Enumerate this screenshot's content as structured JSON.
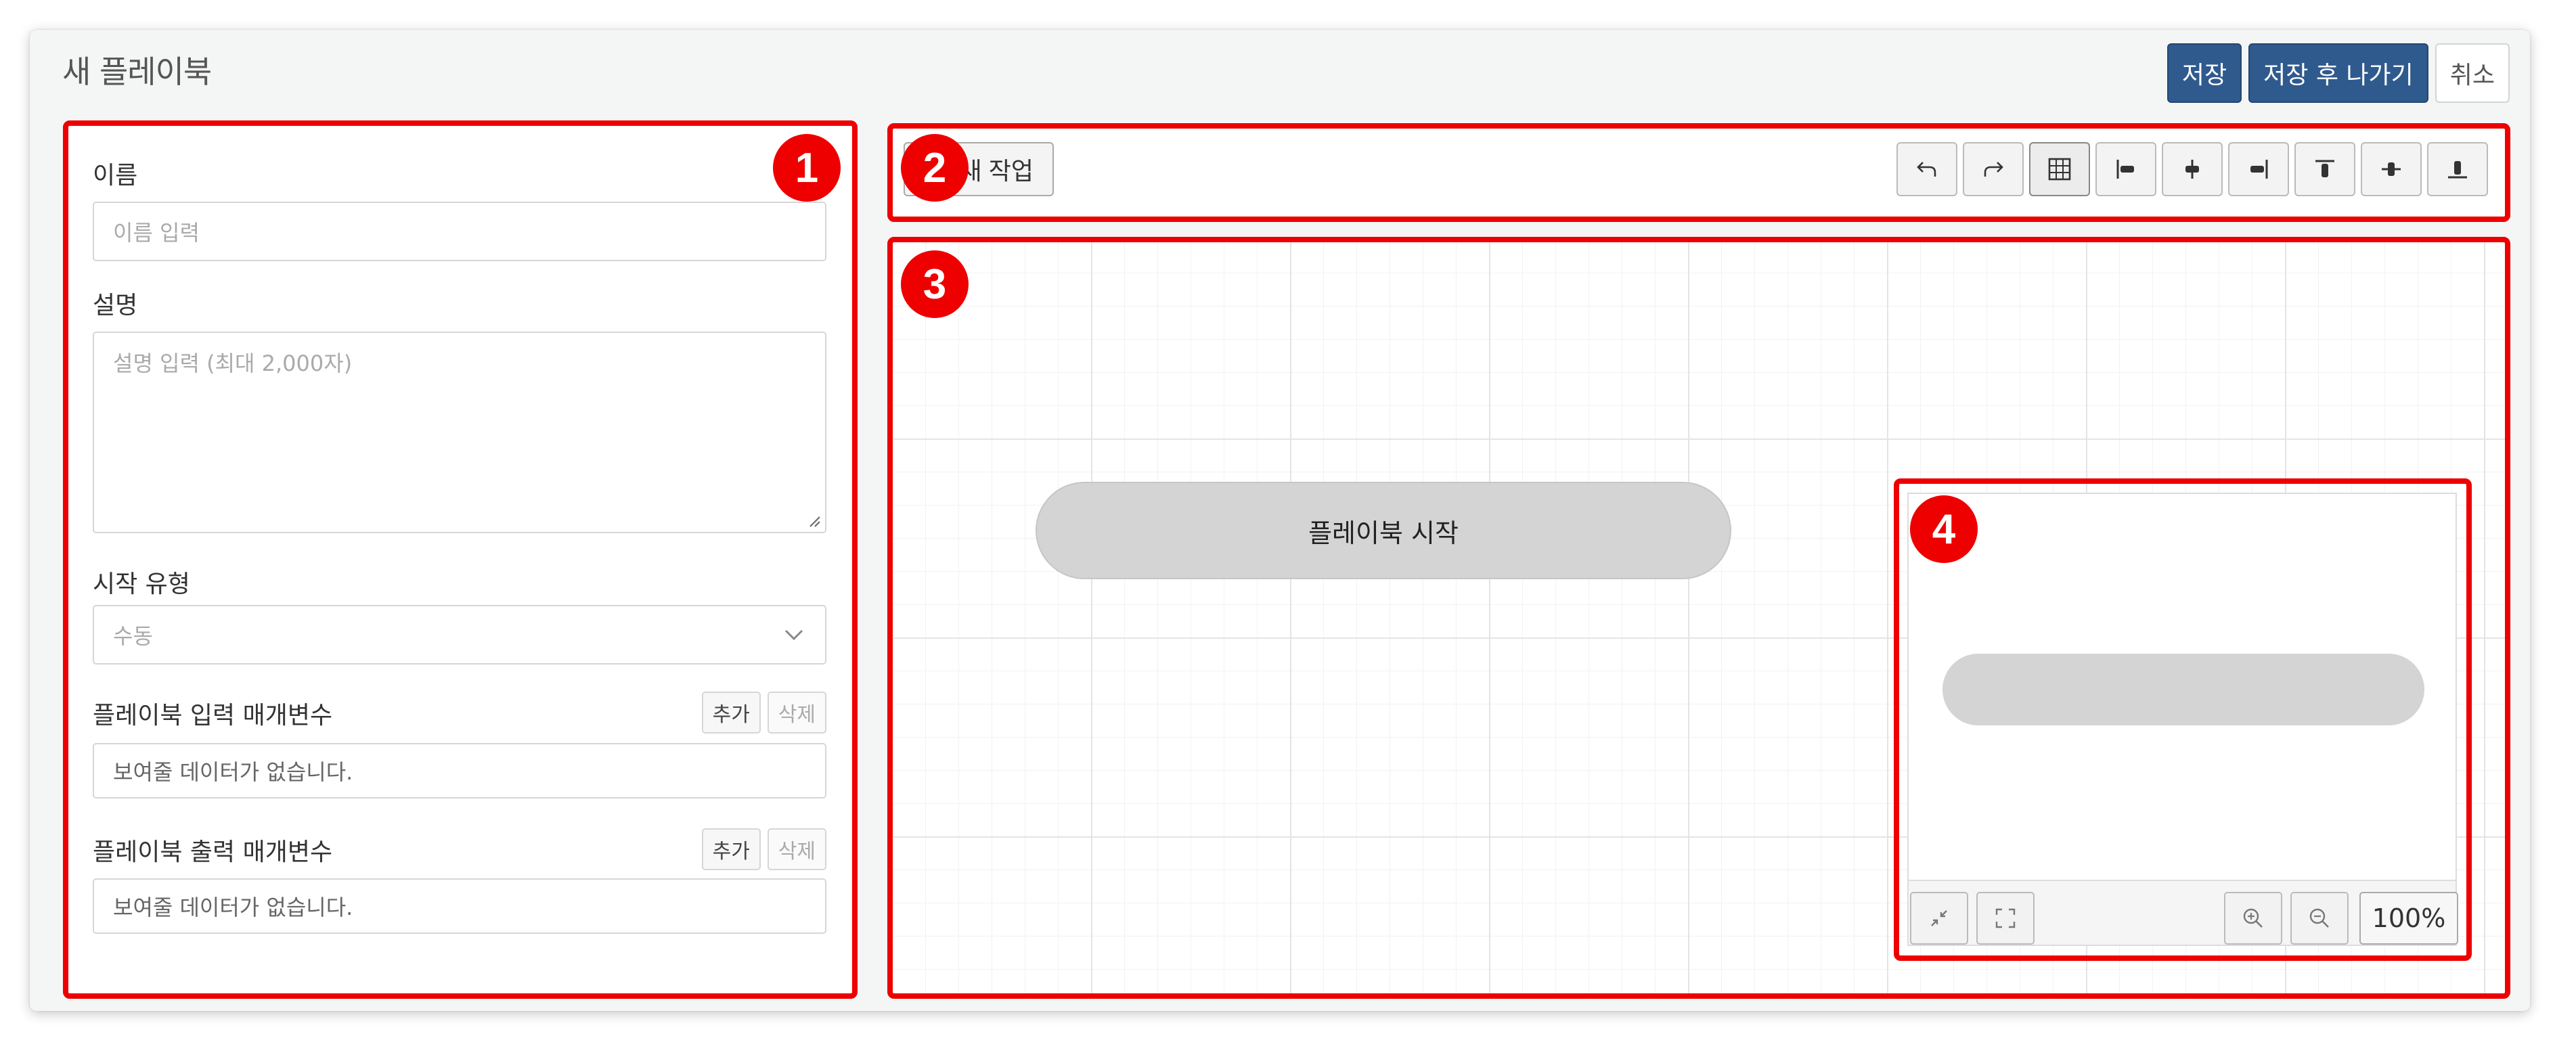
{
  "header": {
    "title": "새 플레이북",
    "save_label": "저장",
    "save_exit_label": "저장 후 나가기",
    "cancel_label": "취소"
  },
  "callouts": [
    "1",
    "2",
    "3",
    "4"
  ],
  "form": {
    "name": {
      "label": "이름",
      "placeholder": "이름 입력"
    },
    "description": {
      "label": "설명",
      "placeholder": "설명 입력 (최대 2,000자)"
    },
    "start_type": {
      "label": "시작 유형",
      "selected": "수동"
    },
    "input_params": {
      "label": "플레이북 입력 매개변수",
      "add_label": "추가",
      "delete_label": "삭제",
      "empty_text": "보여줄 데이터가 없습니다."
    },
    "output_params": {
      "label": "플레이북 출력 매개변수",
      "add_label": "추가",
      "delete_label": "삭제",
      "empty_text": "보여줄 데이터가 없습니다."
    }
  },
  "toolbar": {
    "new_task_label": "새 작업",
    "tools": [
      "undo-icon",
      "redo-icon",
      "grid-icon",
      "align-left-icon",
      "align-center-icon",
      "align-right-icon",
      "align-top-icon",
      "align-middle-icon",
      "align-bottom-icon"
    ]
  },
  "canvas": {
    "start_node_label": "플레이북 시작"
  },
  "minimap": {
    "zoom_label": "100%",
    "buttons": [
      "collapse-icon",
      "fullscreen-icon",
      "zoom-in-icon",
      "zoom-out-icon"
    ]
  },
  "colors": {
    "primary": "#2f5a8e",
    "callout": "#ee0000",
    "node": "#d4d4d4"
  }
}
